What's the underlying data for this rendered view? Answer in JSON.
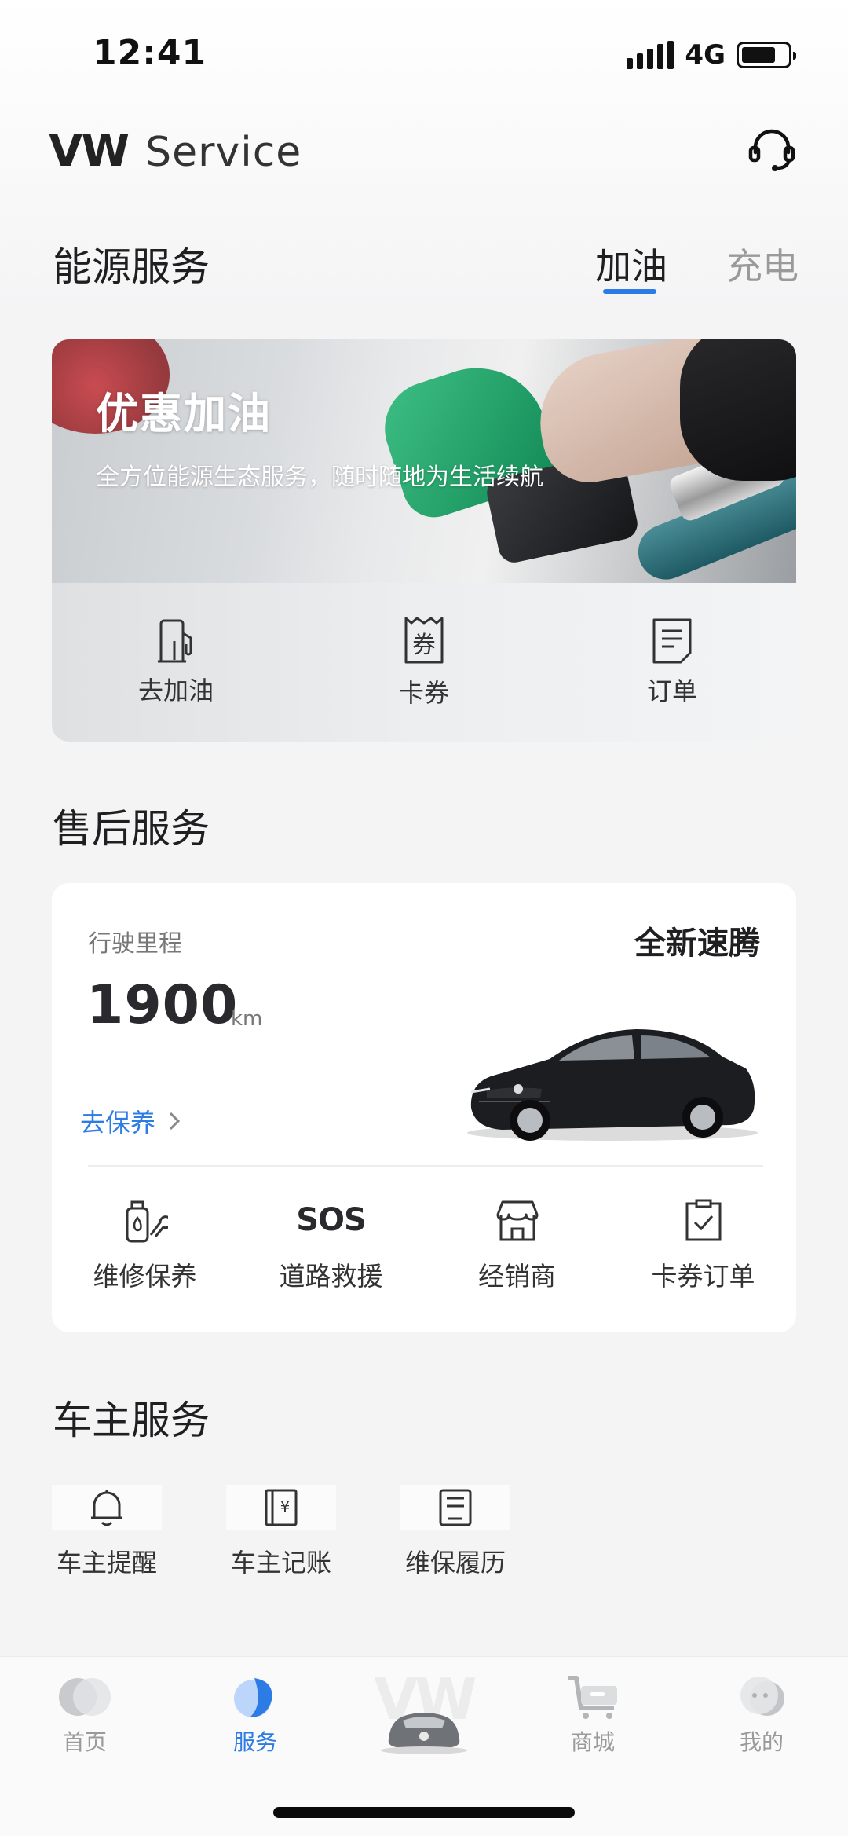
{
  "status_bar": {
    "time": "12:41",
    "network": "4G"
  },
  "header": {
    "brand_logo": "VW",
    "brand_text": "Service"
  },
  "energy": {
    "title": "能源服务",
    "tabs": [
      {
        "label": "加油",
        "active": true
      },
      {
        "label": "充电",
        "active": false
      }
    ],
    "banner": {
      "title": "优惠加油",
      "subtitle": "全方位能源生态服务，随时随地为生活续航"
    },
    "actions": [
      {
        "label": "去加油",
        "icon": "fuel-pump-icon"
      },
      {
        "label": "卡券",
        "icon": "coupon-icon"
      },
      {
        "label": "订单",
        "icon": "order-icon"
      }
    ]
  },
  "after_sales": {
    "title": "售后服务",
    "mileage_label": "行驶里程",
    "mileage_value": "1900",
    "mileage_unit": "km",
    "model": "全新速腾",
    "maintenance_link": "去保养",
    "actions": [
      {
        "label": "维修保养",
        "icon": "maintenance-icon"
      },
      {
        "label": "道路救援",
        "icon": "sos-icon",
        "glyph": "SOS"
      },
      {
        "label": "经销商",
        "icon": "dealer-store-icon"
      },
      {
        "label": "卡券订单",
        "icon": "coupon-order-icon"
      }
    ]
  },
  "owner": {
    "title": "车主服务",
    "items": [
      {
        "label": "车主提醒",
        "icon": "bell-icon"
      },
      {
        "label": "车主记账",
        "icon": "ledger-icon"
      },
      {
        "label": "维保履历",
        "icon": "service-record-icon"
      }
    ]
  },
  "bottom_nav": {
    "items": [
      {
        "label": "首页",
        "active": false
      },
      {
        "label": "服务",
        "active": true
      },
      {
        "label": "商城",
        "active": false
      },
      {
        "label": "我的",
        "active": false
      }
    ]
  },
  "colors": {
    "accent": "#2d7be5",
    "inactive": "#9a9a9a",
    "text": "#1f1f22"
  }
}
